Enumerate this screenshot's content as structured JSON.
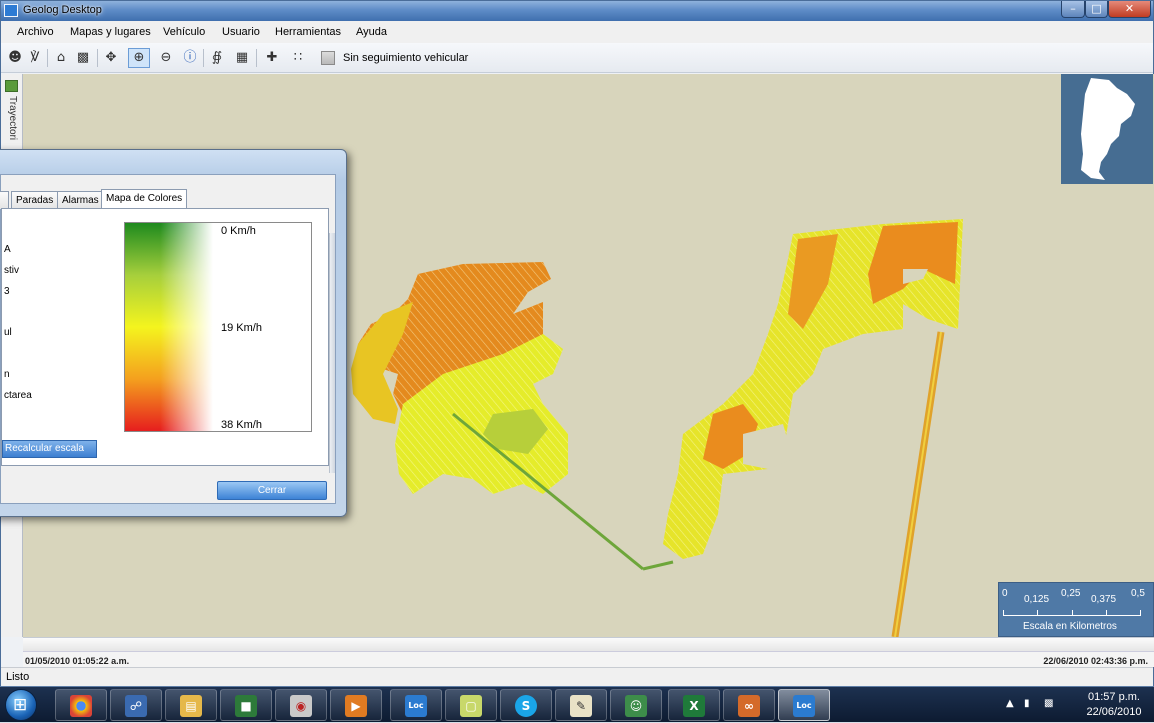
{
  "window": {
    "title": "Geolog Desktop"
  },
  "menu": {
    "items": [
      "Archivo",
      "Mapas y lugares",
      "Vehículo",
      "Usuario",
      "Herramientas",
      "Ayuda"
    ]
  },
  "toolbar": {
    "follow_label": "Sin seguimiento vehicular"
  },
  "side_tab": {
    "label": "Trayectori"
  },
  "dialog": {
    "tabs": [
      "Paradas",
      "Alarmas",
      "Mapa de Colores"
    ],
    "active_tab": "Mapa de Colores",
    "left_fragments": [
      "A",
      "stiv",
      "3",
      "ul",
      "n",
      "ctarea"
    ],
    "legend": {
      "top": "0 Km/h",
      "mid": "19 Km/h",
      "bottom": "38 Km/h"
    },
    "recalc_label": "Recalcular escala",
    "close_label": "Cerrar"
  },
  "scale": {
    "labels": [
      "0",
      "0,125",
      "0,25",
      "0,375",
      "0,5"
    ],
    "caption": "Escala en Kilometros"
  },
  "timeline": {
    "start": "01/05/2010 01:05:22 a.m.",
    "end": "22/06/2010 02:43:36 p.m."
  },
  "status": {
    "text": "Listo"
  },
  "taskbar": {
    "apps": [
      "chrome-icon",
      "network-icon",
      "folder-icon",
      "lock-icon",
      "app-icon",
      "media-icon",
      "geoloc-icon",
      "sticky-icon",
      "skype-icon",
      "notepad-icon",
      "messenger-icon",
      "excel-icon",
      "infinity-icon",
      "geoloc-icon"
    ],
    "time": "01:57 p.m.",
    "date": "22/06/2010"
  },
  "colors": {
    "slow": "#1e8a1e",
    "medium": "#f4f41e",
    "fast": "#e61e1e",
    "map_bg": "#d8d5bc"
  }
}
